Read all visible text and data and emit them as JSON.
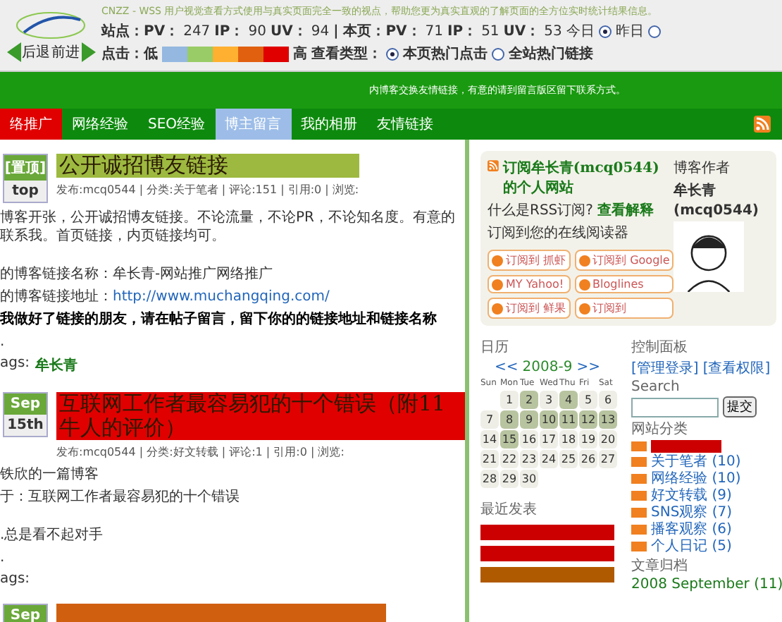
{
  "toolbar": {
    "back": "后退",
    "forward": "前进",
    "description": "CNZZ - WSS 用户视觉查看方式使用与真实页面完全一致的视点，帮助您更为真实直观的了解页面的全方位实时统计结果信息。",
    "stats": [
      {
        "label": "站点：PV：",
        "value": "247"
      },
      {
        "label": "IP：",
        "value": "90"
      },
      {
        "label": "UV：",
        "value": "94"
      },
      {
        "label": "| 本页：PV：",
        "value": "71"
      },
      {
        "label": "IP：",
        "value": "51"
      },
      {
        "label": "UV：",
        "value": "53"
      }
    ],
    "days": [
      {
        "label": "今日",
        "selected": true
      },
      {
        "label": "昨日",
        "selected": false
      }
    ],
    "click_label": "点击：低",
    "click_high": "高",
    "heat_legend": [
      {
        "color": "#94b8e0"
      },
      {
        "color": "#99cc66"
      },
      {
        "color": "#ffb030"
      },
      {
        "color": "#e06010"
      },
      {
        "color": "#e00000"
      }
    ],
    "view_type_label": "查看类型：",
    "view_types": [
      {
        "label": "本页热门点击",
        "selected": true
      },
      {
        "label": "全站热门链接",
        "selected": false
      }
    ]
  },
  "notice": "内博客交换友情链接，有意的请到留言版区留下联系方式。",
  "nav": [
    {
      "label": "络推广",
      "selected": false,
      "color": "#e00000"
    },
    {
      "label": "网络经验",
      "selected": false
    },
    {
      "label": "SEO经验",
      "selected": false
    },
    {
      "label": "博主留言",
      "selected": true
    },
    {
      "label": "我的相册",
      "selected": false
    },
    {
      "label": "友情链接",
      "selected": false
    }
  ],
  "posts": [
    {
      "badge_top": "[置顶]",
      "badge_bottom": "top",
      "title": "公开诚招博友链接",
      "color": "#9db940",
      "meta": "发布:mcq0544 | 分类:关于笔者 | 评论:151 | 引用:0 | 浏览:",
      "body": [
        {
          "kind": "text",
          "text": "博客开张，公开诚招博友链接。不论流量，不论PR，不论知名度。有意的联系我。首页链接，内页链接均可。"
        },
        {
          "kind": "gap"
        },
        {
          "kind": "text",
          "text": "的博客链接名称：牟长青-网站推广网络推广"
        },
        {
          "kind": "link",
          "text": "的博客链接地址：",
          "link": "http://www.muchangqing.com/"
        },
        {
          "kind": "bold",
          "text": "我做好了链接的朋友，请在帖子留言，留下你的的链接地址和链接名称"
        },
        {
          "kind": "text",
          "text": "."
        }
      ],
      "tags_label": "ags:",
      "tags": "牟长青"
    },
    {
      "badge_top": "Sep",
      "badge_bottom": "15th",
      "title": "互联网工作者最容易犯的十个错误（附11牛人的评价）",
      "color": "#e00000",
      "meta": "发布:mcq0544 | 分类:好文转载 | 评论:1 | 引用:0 | 浏览:",
      "body": [
        {
          "kind": "text",
          "text": "铁欣的一篇博客"
        },
        {
          "kind": "text",
          "text": "于：互联网工作者最容易犯的十个错误"
        },
        {
          "kind": "gap"
        },
        {
          "kind": "text",
          "text": ".总是看不起对手"
        },
        {
          "kind": "text",
          "text": "."
        }
      ],
      "tags_label": "ags:"
    },
    {
      "badge_top": "Sep",
      "color": "#d06010"
    }
  ],
  "subscribe": {
    "title": "订阅牟长青(mcq0544)的个人网站",
    "question": "什么是RSS订阅?",
    "explain": "查看解释",
    "reader": "订阅到您的在线阅读器",
    "buttons": [
      "订阅到 抓虾",
      "订阅到 Google",
      "MY Yahoo!",
      "Bloglines",
      "订阅到 鲜果",
      "订阅到"
    ]
  },
  "author": {
    "heading": "博客作者",
    "name": "牟长青",
    "id": "(mcq0544)"
  },
  "calendar": {
    "heading": "日历",
    "prev": "<<",
    "month": "2008-9",
    "next": ">>",
    "weekdays": [
      "Sun",
      "Mon",
      "Tue",
      "Wed",
      "Thu",
      "Fri",
      "Sat"
    ],
    "days": [
      {
        "day": "1",
        "posted": false
      },
      {
        "day": "2",
        "posted": true
      },
      {
        "day": "3",
        "posted": false
      },
      {
        "day": "4",
        "posted": true
      },
      {
        "day": "5",
        "posted": false
      },
      {
        "day": "6",
        "posted": false
      },
      {
        "day": "7",
        "posted": false
      },
      {
        "day": "8",
        "posted": true
      },
      {
        "day": "9",
        "posted": true
      },
      {
        "day": "10",
        "posted": true
      },
      {
        "day": "11",
        "posted": true
      },
      {
        "day": "12",
        "posted": true
      },
      {
        "day": "13",
        "posted": true
      },
      {
        "day": "14",
        "posted": false
      },
      {
        "day": "15",
        "posted": true
      },
      {
        "day": "16",
        "posted": false
      },
      {
        "day": "17",
        "posted": false
      },
      {
        "day": "18",
        "posted": false
      },
      {
        "day": "19",
        "posted": false
      },
      {
        "day": "20",
        "posted": false
      },
      {
        "day": "21",
        "posted": false
      },
      {
        "day": "22",
        "posted": false
      },
      {
        "day": "23",
        "posted": false
      },
      {
        "day": "24",
        "posted": false
      },
      {
        "day": "25",
        "posted": false
      },
      {
        "day": "26",
        "posted": false
      },
      {
        "day": "27",
        "posted": false
      },
      {
        "day": "28",
        "posted": false
      },
      {
        "day": "29",
        "posted": false
      },
      {
        "day": "30",
        "posted": false
      }
    ]
  },
  "recent": {
    "heading": "最近发表",
    "items": [
      {
        "color": "#cc0000"
      },
      {
        "color": "#cc0000"
      },
      {
        "color": "#b05a00"
      }
    ]
  },
  "control": {
    "heading": "控制面板",
    "links": [
      "[管理登录]",
      "[查看权限]"
    ]
  },
  "search": {
    "heading": "Search",
    "button": "提交"
  },
  "categories": {
    "heading": "网站分类",
    "items": [
      {
        "color": "#cc0000"
      },
      {
        "label": "关于笔者",
        "count": "(10)"
      },
      {
        "label": "网络经验",
        "count": "(10)"
      },
      {
        "label": "好文转载",
        "count": "(9)"
      },
      {
        "label": "SNS观察",
        "count": "(7)"
      },
      {
        "label": "播客观察",
        "count": "(6)"
      },
      {
        "label": "个人日记",
        "count": "(5)"
      }
    ]
  },
  "archive": {
    "heading": "文章归档",
    "items": [
      "2008 September (11)"
    ]
  }
}
